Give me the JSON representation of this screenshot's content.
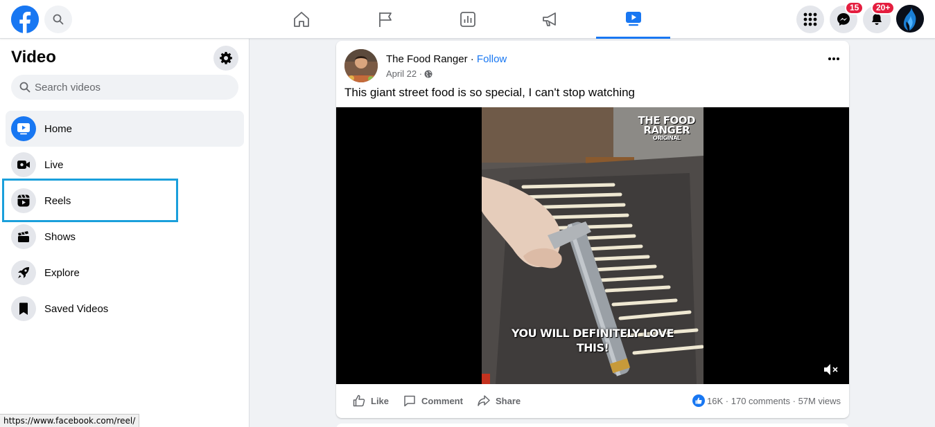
{
  "topbar": {
    "nav_tabs": [
      "home-icon",
      "flag-icon",
      "chart-icon",
      "megaphone-icon",
      "video-icon"
    ],
    "messenger_badge": "15",
    "notifications_badge": "20+"
  },
  "sidebar": {
    "title": "Video",
    "search_placeholder": "Search videos",
    "items": [
      {
        "label": "Home",
        "icon": "video-home-icon"
      },
      {
        "label": "Live",
        "icon": "live-camera-icon"
      },
      {
        "label": "Reels",
        "icon": "reels-icon"
      },
      {
        "label": "Shows",
        "icon": "clapperboard-icon"
      },
      {
        "label": "Explore",
        "icon": "rocket-icon"
      },
      {
        "label": "Saved Videos",
        "icon": "bookmark-icon"
      }
    ]
  },
  "post": {
    "author": "The Food Ranger",
    "separator": " · ",
    "follow": "Follow",
    "date": "April 22 ·",
    "text": "This giant street food is so special, I can't stop watching",
    "video": {
      "brand_line1": "THE FOOD",
      "brand_line2": "RANGER",
      "brand_line3": "ORIGINAL",
      "caption_line1": "YOU WILL DEFINITELY LOVE",
      "caption_line2": "THIS!"
    },
    "actions": {
      "like": "Like",
      "comment": "Comment",
      "share": "Share"
    },
    "stats": {
      "reactions": "16K",
      "dot": " · ",
      "comments": "170 comments",
      "views": "57M views"
    }
  },
  "status_bar": {
    "url": "https://www.facebook.com/reel/"
  },
  "colors": {
    "accent": "#1877f2",
    "highlight": "#1a9fdb",
    "badge": "#e41e3f"
  }
}
